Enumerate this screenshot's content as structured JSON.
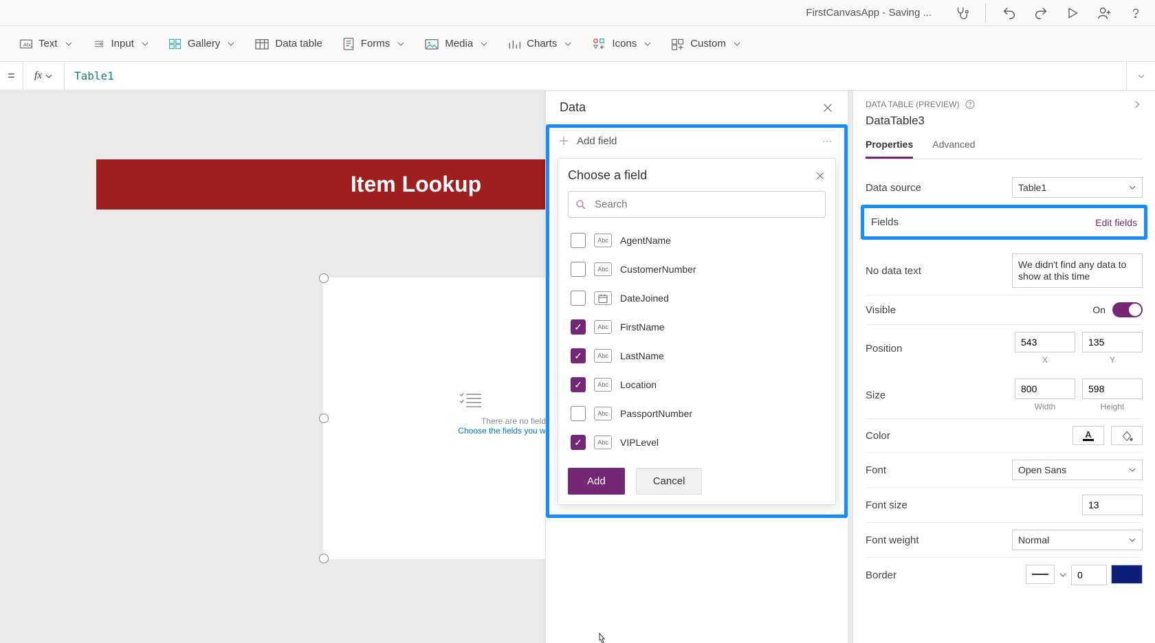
{
  "titlebar": {
    "title": "FirstCanvasApp - Saving ..."
  },
  "ribbon": {
    "text": "Text",
    "input": "Input",
    "gallery": "Gallery",
    "dataTable": "Data table",
    "forms": "Forms",
    "media": "Media",
    "charts": "Charts",
    "icons": "Icons",
    "custom": "Custom"
  },
  "formula": {
    "value": "Table1"
  },
  "canvas": {
    "appTitle": "Item Lookup",
    "placeholder1": "There are no fields",
    "placeholder2": "Choose the fields you want to a"
  },
  "dataPanel": {
    "header": "Data",
    "addField": "Add field",
    "popup": {
      "title": "Choose a field",
      "searchPlaceholder": "Search",
      "add": "Add",
      "cancel": "Cancel",
      "fields": [
        {
          "name": "AgentName",
          "type": "Abc",
          "checked": false
        },
        {
          "name": "CustomerNumber",
          "type": "Abc",
          "checked": false
        },
        {
          "name": "DateJoined",
          "type": "Date",
          "checked": false
        },
        {
          "name": "FirstName",
          "type": "Abc",
          "checked": true
        },
        {
          "name": "LastName",
          "type": "Abc",
          "checked": true
        },
        {
          "name": "Location",
          "type": "Abc",
          "checked": true
        },
        {
          "name": "PassportNumber",
          "type": "Abc",
          "checked": false
        },
        {
          "name": "VIPLevel",
          "type": "Abc",
          "checked": true
        }
      ]
    }
  },
  "props": {
    "category": "DATA TABLE (PREVIEW)",
    "name": "DataTable3",
    "tabProps": "Properties",
    "tabAdv": "Advanced",
    "dataSourceLabel": "Data source",
    "dataSourceValue": "Table1",
    "fieldsLabel": "Fields",
    "editFields": "Edit fields",
    "noDataLabel": "No data text",
    "noDataValue": "We didn't find any data to show at this time",
    "visibleLabel": "Visible",
    "visibleValue": "On",
    "positionLabel": "Position",
    "posX": "543",
    "posY": "135",
    "xLabel": "X",
    "yLabel": "Y",
    "sizeLabel": "Size",
    "width": "800",
    "height": "598",
    "wLabel": "Width",
    "hLabel": "Height",
    "colorLabel": "Color",
    "fontLabel": "Font",
    "fontValue": "Open Sans",
    "fontSizeLabel": "Font size",
    "fontSizeValue": "13",
    "fontWeightLabel": "Font weight",
    "fontWeightValue": "Normal",
    "borderLabel": "Border",
    "borderValue": "0"
  }
}
